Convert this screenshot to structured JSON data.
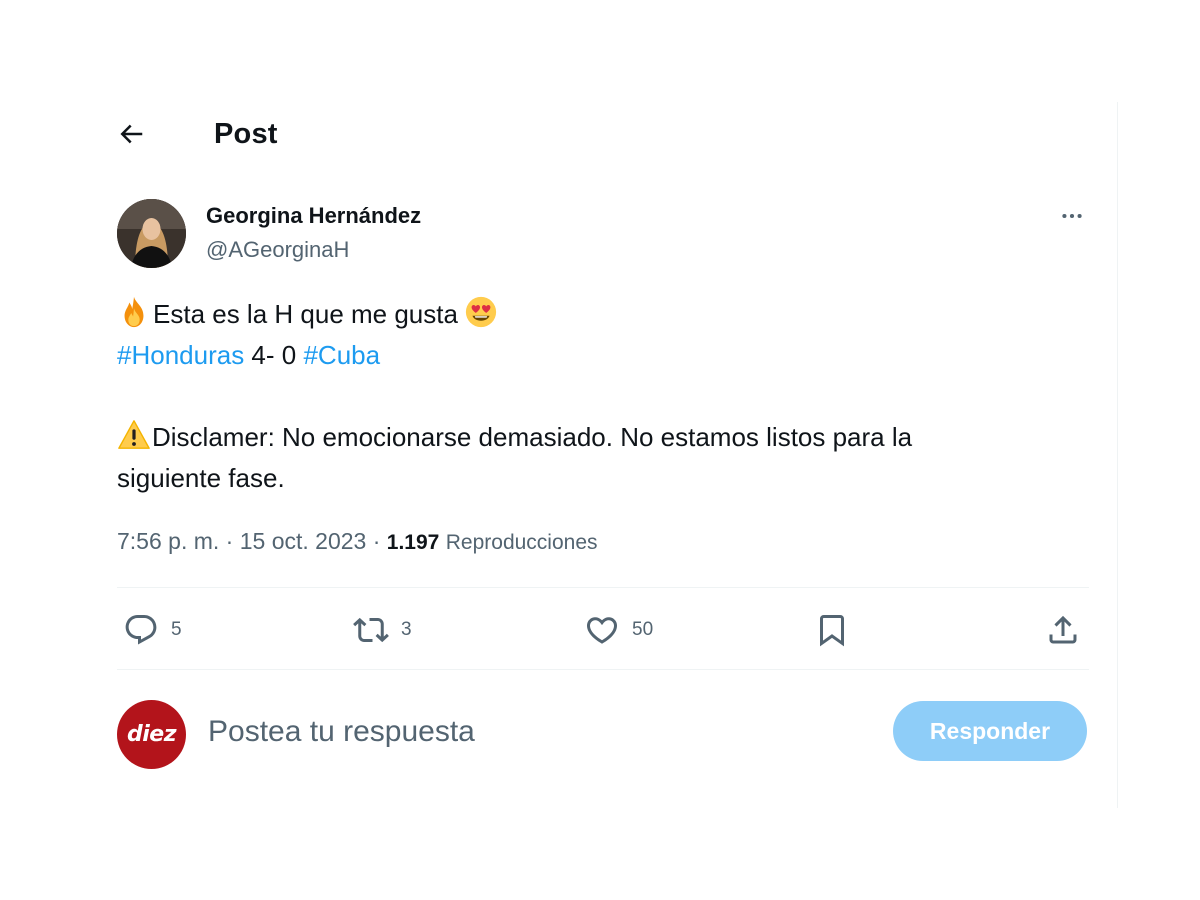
{
  "header": {
    "title": "Post"
  },
  "author": {
    "name": "Georgina Hernández",
    "handle": "@AGeorginaH"
  },
  "tweet": {
    "line1": "Esta es la H que me gusta",
    "hashtag1": "#Honduras",
    "score": " 4- 0 ",
    "hashtag2": "#Cuba",
    "line3a": "Disclamer: No emocionarse demasiado. No estamos listos para la",
    "line3b": "siguiente fase.",
    "emojis": [
      "fire",
      "smiling-face-with-heart-eyes",
      "warning"
    ]
  },
  "meta": {
    "time": "7:56 p. m.",
    "separator": " · ",
    "date": "15 oct. 2023",
    "separator2": " · ",
    "views_count": "1.197",
    "views_label": "Reproducciones"
  },
  "actions": {
    "replies": "5",
    "reposts": "3",
    "likes": "50",
    "icons": [
      "reply-icon",
      "repost-icon",
      "like-icon",
      "bookmark-icon",
      "share-icon"
    ]
  },
  "reply_box": {
    "avatar_text": "diez",
    "placeholder": "Postea tu respuesta",
    "button_label": "Responder"
  },
  "colors": {
    "link": "#1d9bf0",
    "secondary_text": "#536471",
    "reply_button": "#8ecdf8",
    "divider": "#eff3f4",
    "diez_red": "#b3141b"
  }
}
